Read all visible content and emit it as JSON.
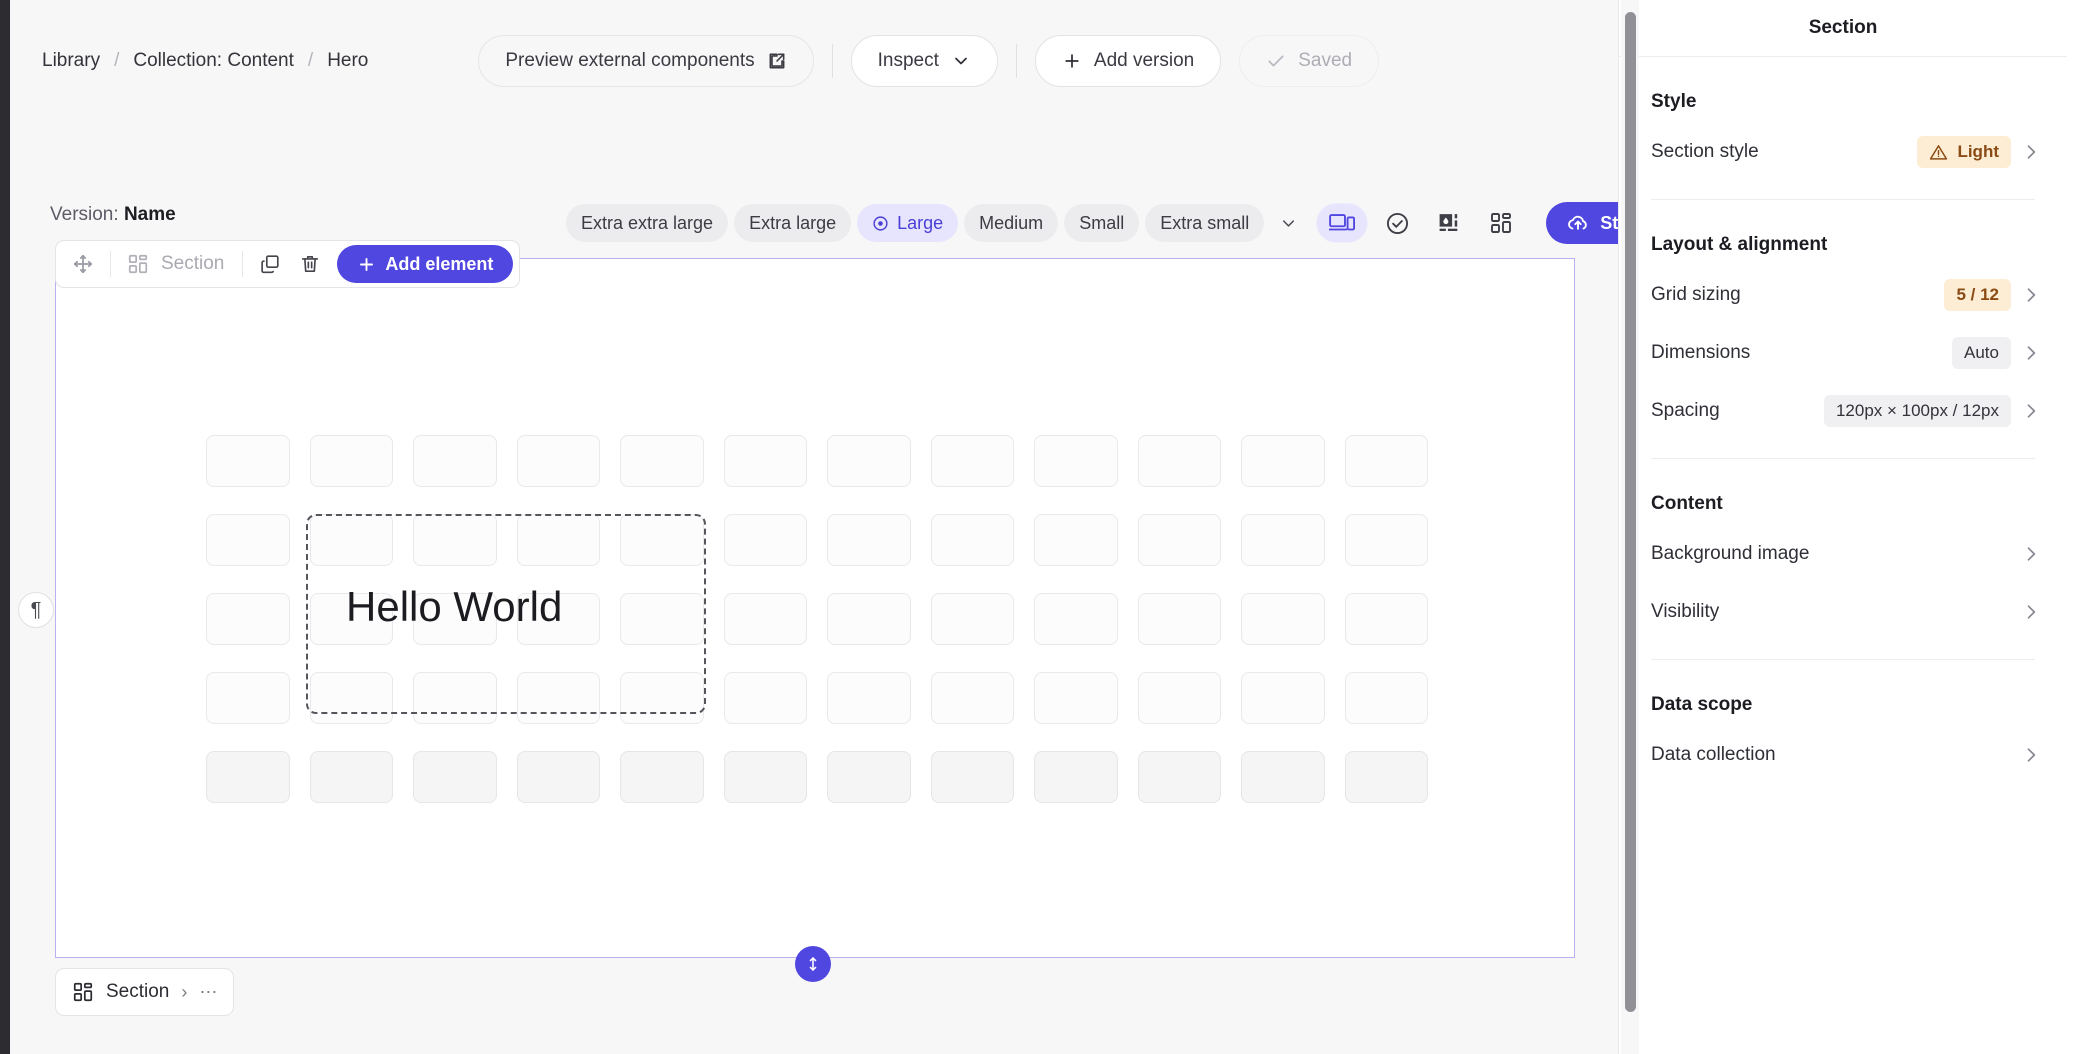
{
  "breadcrumb": {
    "items": [
      {
        "label": "Library"
      },
      {
        "label": "Collection:  Content"
      },
      {
        "label": "Hero"
      }
    ],
    "separator": "/"
  },
  "header": {
    "preview_button": "Preview external components",
    "preview_icon": "external-link-icon",
    "inspect_button": "Inspect",
    "inspect_icon": "chevron-down-icon",
    "add_version_button": "Add version",
    "add_version_icon": "plus-icon",
    "saved_button": "Saved",
    "saved_icon": "check-icon"
  },
  "version": {
    "prefix": "Version:",
    "name": "Name"
  },
  "breakpoints": {
    "options": [
      {
        "label": "Extra extra large",
        "active": false
      },
      {
        "label": "Extra large",
        "active": false
      },
      {
        "label": "Large",
        "active": true,
        "icon": "eye-target-icon"
      },
      {
        "label": "Medium",
        "active": false
      },
      {
        "label": "Small",
        "active": false
      },
      {
        "label": "Extra small",
        "active": false
      }
    ],
    "caret_icon": "chevron-down-icon",
    "tools": [
      {
        "name": "device-preview-icon",
        "active": true
      },
      {
        "name": "check-circle-icon",
        "active": false
      },
      {
        "name": "contrast-theme-icon",
        "active": false
      },
      {
        "name": "grid-layout-icon",
        "active": false
      }
    ],
    "stage_button": "Stage",
    "stage_icon": "cloud-upload-icon",
    "more_icon": "more-horizontal-icon",
    "more_label": "•••"
  },
  "section_toolbar": {
    "move_icon": "move-handle-icon",
    "grid_icon": "grid-layout-icon",
    "label": "Section",
    "duplicate_icon": "duplicate-icon",
    "delete_icon": "trash-icon",
    "add_element_button": "Add element",
    "add_element_icon": "plus-icon"
  },
  "canvas": {
    "text_element": "Hello World",
    "columns": 12,
    "rows": 5,
    "shaded_row_index": 4,
    "selection": {
      "cols": 4,
      "rows": 3
    },
    "resize_icon": "resize-vertical-icon",
    "pilcrow_icon": "paragraph-icon",
    "pilcrow_glyph": "¶"
  },
  "bottom_chip": {
    "icon": "grid-layout-icon",
    "label": "Section",
    "chevron": "›",
    "more": "⋯"
  },
  "panel": {
    "title": "Section",
    "groups": [
      {
        "title": "Style",
        "rows": [
          {
            "label": "Section style",
            "value": "Light",
            "badge": "warn",
            "icon": "warning-triangle-icon",
            "chevron": true
          }
        ]
      },
      {
        "title": "Layout & alignment",
        "rows": [
          {
            "label": "Grid sizing",
            "value": "5 / 12",
            "badge": "amber",
            "chevron": true
          },
          {
            "label": "Dimensions",
            "value": "Auto",
            "badge": "neutral",
            "chevron": true
          },
          {
            "label": "Spacing",
            "value": "120px × 100px / 12px",
            "badge": "neutral",
            "chevron": true
          }
        ]
      },
      {
        "title": "Content",
        "rows": [
          {
            "label": "Background image",
            "value": "",
            "badge": "",
            "chevron": true
          },
          {
            "label": "Visibility",
            "value": "",
            "badge": "",
            "chevron": true
          }
        ]
      },
      {
        "title": "Data scope",
        "rows": [
          {
            "label": "Data collection",
            "value": "",
            "badge": "",
            "chevron": true
          }
        ]
      }
    ]
  },
  "colors": {
    "accent": "#5046e0",
    "accent_soft": "#e7e4fd",
    "warn_bg": "#fdedd4",
    "warn_fg": "#8a4b14",
    "canvas_border": "#b8b2f0"
  }
}
